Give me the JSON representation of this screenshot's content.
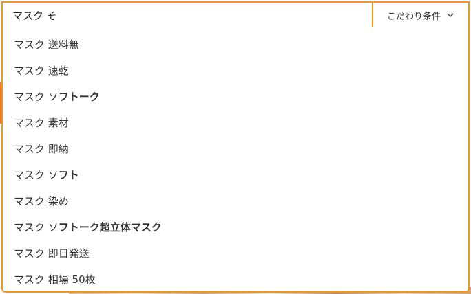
{
  "search": {
    "value": "マスク そ",
    "filter_label": "こだわり条件",
    "filter_icon": "chevron-down-icon"
  },
  "suggestions": [
    {
      "prefix": "マスク 送料無",
      "rest": ""
    },
    {
      "prefix": "マスク 速乾",
      "rest": ""
    },
    {
      "prefix": "マスク ソ",
      "rest": "フトーク"
    },
    {
      "prefix": "マスク 素材",
      "rest": ""
    },
    {
      "prefix": "マスク 即納",
      "rest": ""
    },
    {
      "prefix": "マスク ソ",
      "rest": "フト"
    },
    {
      "prefix": "マスク 染め",
      "rest": ""
    },
    {
      "prefix": "マスク ソ",
      "rest": "フトーク超立体マスク"
    },
    {
      "prefix": "マスク 即日発送",
      "rest": ""
    },
    {
      "prefix": "マスク 相場 50枚",
      "rest": ""
    }
  ],
  "colors": {
    "accent": "#f0961e",
    "text": "#333333"
  }
}
